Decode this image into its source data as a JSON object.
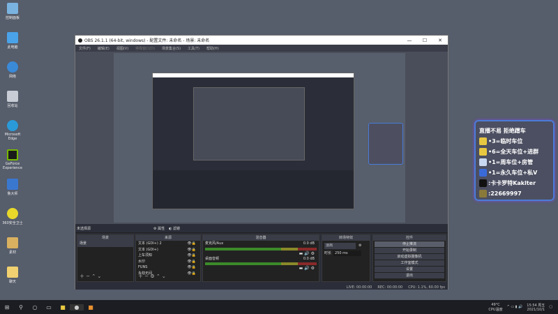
{
  "desktop": {
    "icons": [
      "控制面板",
      "此电脑",
      "网络",
      "回收站",
      "Microsoft Edge",
      "GeForce Experience",
      "鲁大师",
      "360安全卫士",
      "素材",
      "聊天"
    ]
  },
  "window": {
    "title": "OBS 26.1.1 (64-bit, windows) - 配置文件: 未命名 - 场景: 未命名",
    "min": "—",
    "max": "☐",
    "close": "✕"
  },
  "menu": [
    "文件(F)",
    "编辑(E)",
    "视图(V)",
    "停靠窗口(D)",
    "场景集合(S)",
    "工具(T)",
    "帮助(H)"
  ],
  "source_bar": {
    "label": "未选择源",
    "properties": "⚙ 属性",
    "filters": "◐ 滤镜"
  },
  "docks": {
    "scenes": {
      "title": "场景",
      "items": [
        "场景"
      ]
    },
    "sources": {
      "title": "来源",
      "items": [
        "文本 (GDI+) 2",
        "文本 (GDI+)",
        "上车须知",
        "水印",
        "FUNS",
        "永劫无间"
      ]
    },
    "mixer": {
      "title": "混音器",
      "channels": [
        {
          "name": "麦克风/Aux",
          "db": "0.0 dB"
        },
        {
          "name": "桌面音频",
          "db": "0.0 dB"
        }
      ]
    },
    "transitions": {
      "title": "转场特效",
      "type": "淡出",
      "duration_label": "时长",
      "duration": "250 ms"
    },
    "controls": {
      "title": "控件",
      "buttons": [
        "停止推流",
        "开始录制",
        "启动虚拟摄像机",
        "工作室模式",
        "设置",
        "退出"
      ]
    }
  },
  "status": {
    "live": "LIVE: 00:00:00",
    "rec": "REC: 00:00:00",
    "cpu": "CPU: 1.1%, 60.00 fps"
  },
  "overlay": {
    "title": "直播不易 拒绝蹭车",
    "lines": [
      "•3=临时车位",
      "•6=全天车位+进群",
      "•1=周车位+房管",
      "•1=永久车位+私V",
      ":卡卡罗特Kaklter",
      ":22669997"
    ]
  },
  "taskbar": {
    "temp": "49°C",
    "temp_label": "CPU温度",
    "time": "15:54 周五",
    "date": "2021/10/1"
  }
}
